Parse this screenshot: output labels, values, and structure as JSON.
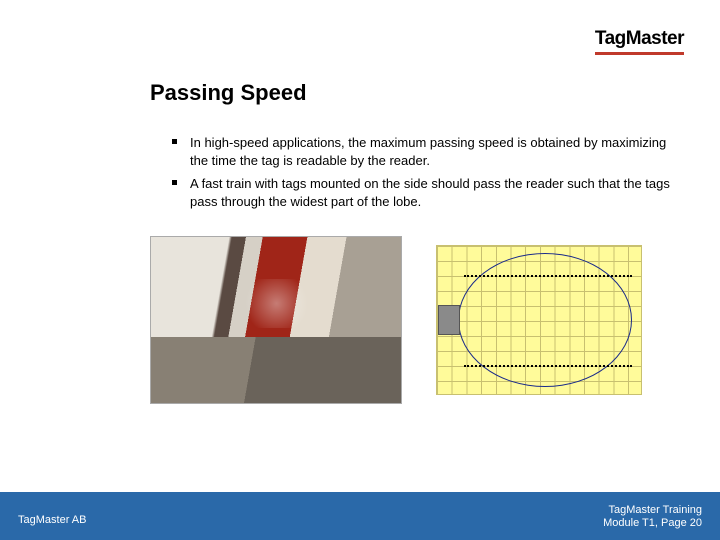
{
  "brand": {
    "name": "TagMaster"
  },
  "slide": {
    "title": "Passing Speed",
    "bullets": [
      "In high-speed applications, the maximum passing speed is obtained by maximizing the time the tag is readable by the reader.",
      "A fast train with tags mounted on the side should pass the reader such that the tags pass through the widest part of the lobe."
    ]
  },
  "footer": {
    "left": "TagMaster AB",
    "right_line1": "TagMaster Training",
    "right_line2": "Module T1, Page 20"
  }
}
